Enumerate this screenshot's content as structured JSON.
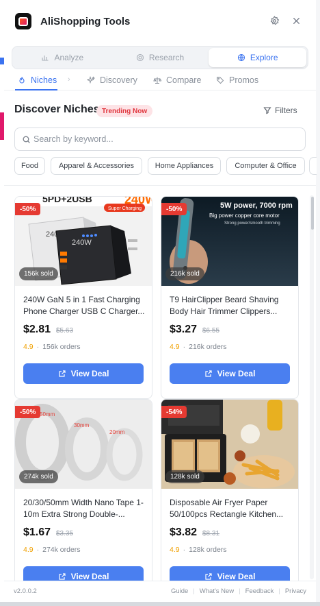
{
  "header": {
    "title": "AliShopping Tools"
  },
  "segments": [
    {
      "label": "Analyze",
      "icon": "bar-chart-icon"
    },
    {
      "label": "Research",
      "icon": "target-icon"
    },
    {
      "label": "Explore",
      "icon": "globe-icon"
    }
  ],
  "subtabs": [
    {
      "label": "Niches",
      "icon": "flame-icon"
    },
    {
      "label": "Discovery",
      "icon": "sparkle-icon"
    },
    {
      "label": "Compare",
      "icon": "scale-icon"
    },
    {
      "label": "Promos",
      "icon": "tag-icon"
    }
  ],
  "discover": {
    "title": "Discover Niches",
    "badge": "Trending Now",
    "filters_label": "Filters",
    "search_placeholder": "Search by keyword..."
  },
  "categories": [
    "Food",
    "Apparel & Accessories",
    "Home Appliances",
    "Computer & Office"
  ],
  "products": [
    {
      "title": "240W GaN 5 in 1 Fast Charging Phone Charger USB C Charger...",
      "price": "$2.81",
      "old_price": "$5.63",
      "discount": "-50%",
      "sold": "156k sold",
      "rating": "4.9",
      "orders": "156k orders",
      "button": "View Deal",
      "image_text": [
        "5PD+2USB",
        "240W",
        "Super Charging"
      ]
    },
    {
      "title": "T9 HairClipper Beard Shaving Body Hair Trimmer Clippers...",
      "price": "$3.27",
      "old_price": "$6.55",
      "discount": "-50%",
      "sold": "216k sold",
      "rating": "4.9",
      "orders": "216k orders",
      "button": "View Deal",
      "image_text": [
        "5W power, 7000 rpm",
        "Big power copper core motor",
        "Strong power/smooth trimming"
      ]
    },
    {
      "title": "20/30/50mm Width Nano Tape 1-10m Extra Strong Double-...",
      "price": "$1.67",
      "old_price": "$3.35",
      "discount": "-50%",
      "sold": "274k sold",
      "rating": "4.9",
      "orders": "274k orders",
      "button": "View Deal",
      "image_text": [
        "50mm",
        "30mm",
        "20mm"
      ]
    },
    {
      "title": "Disposable Air Fryer Paper 50/100pcs Rectangle Kitchen...",
      "price": "$3.82",
      "old_price": "$8.31",
      "discount": "-54%",
      "sold": "128k sold",
      "rating": "4.9",
      "orders": "128k orders",
      "button": "View Deal",
      "image_text": []
    }
  ],
  "footer": {
    "version": "v2.0.0.2",
    "links": [
      "Guide",
      "What's New",
      "Feedback",
      "Privacy"
    ]
  },
  "colors": {
    "accent": "#3b73f0",
    "button": "#4a7ff0",
    "discount": "#e53a32",
    "rating": "#f0a000",
    "badge_bg": "#fde3e6"
  }
}
